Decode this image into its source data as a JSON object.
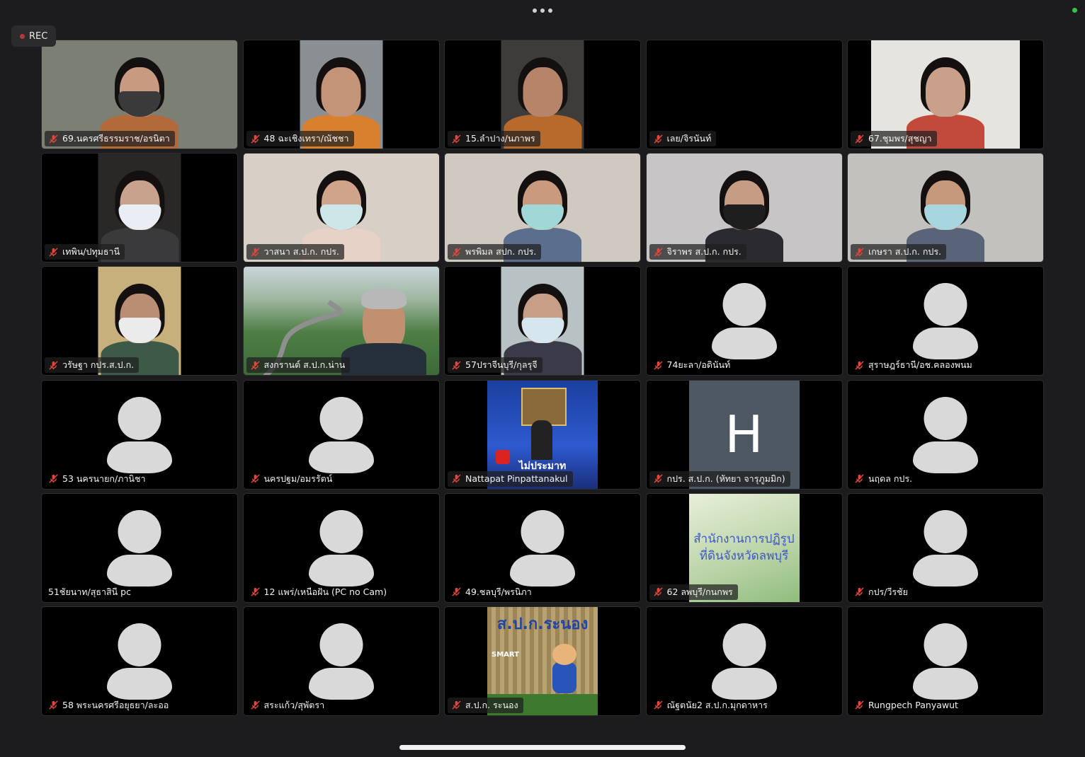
{
  "rec_label": "REC",
  "participants": [
    {
      "name": "69.นครศรีธรรมราช/อรนิตา",
      "muted": true,
      "video": "person",
      "vw": "full",
      "bg": "#7c7f74",
      "skin": "#c89b80",
      "maskc": "#3a3a3a",
      "shirtc": "#b36a3a"
    },
    {
      "name": "48 ฉะเชิงเทรา/ณัชชา",
      "muted": true,
      "video": "person",
      "vw": "v-narrow",
      "bg": "#8a8f94",
      "skin": "#c49479",
      "maskc": "",
      "shirtc": "#d9802e"
    },
    {
      "name": "15.ลำปาง/นภาพร",
      "muted": true,
      "video": "person",
      "vw": "v-narrow",
      "bg": "#3e3c3a",
      "skin": "#b68468",
      "maskc": "",
      "shirtc": "#b86a2c"
    },
    {
      "name": "เลย/จิรนันท์",
      "muted": true,
      "video": "none"
    },
    {
      "name": "67.ชุมพร/สุชญา",
      "muted": true,
      "video": "person",
      "vw": "v-wide",
      "bg": "#e6e4df",
      "skin": "#c9a08a",
      "maskc": "",
      "shirtc": "#c24a3a"
    },
    {
      "name": "เทพิน/ปทุมธานี",
      "muted": true,
      "video": "person",
      "vw": "v-narrow",
      "bg": "#2a2826",
      "skin": "#c8a28c",
      "maskc": "#e8eef4",
      "shirtc": "#3a3a3c"
    },
    {
      "name": "วาสนา ส.ป.ก. กปร.",
      "muted": true,
      "video": "person",
      "vw": "full",
      "bg": "#d8d0c6",
      "skin": "#d0a48a",
      "maskc": "#cde6e8",
      "shirtc": "#e6d2c6"
    },
    {
      "name": "พรพิมล  สปก. กปร.",
      "muted": true,
      "video": "person",
      "vw": "full",
      "bg": "#cfc9c1",
      "skin": "#c99a7e",
      "maskc": "#9fd8d6",
      "shirtc": "#5b6e8e"
    },
    {
      "name": "จิราพร ส.ป.ก. กปร.",
      "muted": true,
      "video": "person",
      "vw": "full",
      "bg": "#c7c5c6",
      "skin": "#c79c84",
      "maskc": "#1e1e1e",
      "shirtc": "#2a2a30"
    },
    {
      "name": "เกษรา ส.ป.ก. กปร.",
      "muted": true,
      "video": "person",
      "vw": "full",
      "bg": "#c2c1bd",
      "skin": "#c6987c",
      "maskc": "#a8d6de",
      "shirtc": "#5a6478"
    },
    {
      "name": "วรัษฐา กปร.ส.ป.ก.",
      "muted": true,
      "video": "person",
      "vw": "v-narrow",
      "bg": "#c8b07c",
      "skin": "#b98e72",
      "maskc": "#ebebeb",
      "shirtc": "#3d5a48"
    },
    {
      "name": "สงกรานต์ ส.ป.ก.น่าน",
      "muted": true,
      "video": "landscape",
      "vw": "full",
      "bg": "#5e8d55",
      "skin": "#c09070",
      "maskc": "",
      "shirtc": "#26303a"
    },
    {
      "name": "57ปราจีนบุรี/กุลรุจี",
      "muted": true,
      "video": "person",
      "vw": "v-narrow",
      "bg": "#b8c2c4",
      "skin": "#c79e86",
      "maskc": "#d6e6ef",
      "shirtc": "#3a3a48"
    },
    {
      "name": "74ยะลา/อดินันท์",
      "muted": true,
      "video": "avatar"
    },
    {
      "name": "สุราษฎร์ธานี/อช.คลองพนม",
      "muted": true,
      "video": "avatar"
    },
    {
      "name": "53 นครนายก/ภานิชา",
      "muted": true,
      "video": "avatar"
    },
    {
      "name": "นครปฐม/อมรรัตน์",
      "muted": true,
      "video": "avatar"
    },
    {
      "name": "Nattapat Pinpattanakul",
      "muted": true,
      "video": "poster",
      "poster_text": "ไม่ประมาท",
      "vw": "v-mid"
    },
    {
      "name": "กปร. ส.ป.ก. (หัทยา จารุภูมมิก)",
      "muted": true,
      "video": "letter",
      "letter": "H",
      "vw": "v-mid"
    },
    {
      "name": "นฤดล กปร.",
      "muted": true,
      "video": "avatar"
    },
    {
      "name": "51ชัยนาท/สุธาสินี pc",
      "muted": false,
      "video": "avatar"
    },
    {
      "name": "12 แพร่/เหนือฝัน (PC no Cam)",
      "muted": true,
      "video": "avatar"
    },
    {
      "name": "49.ชลบุรี/พรนิภา",
      "muted": true,
      "video": "avatar"
    },
    {
      "name": "62 ลพบุรี/กนกพร",
      "muted": true,
      "video": "lopburi",
      "line1": "สำนักงานการปฏิรูป",
      "line2": "ที่ดินจังหวัดลพบุรี",
      "vw": "v-mid"
    },
    {
      "name": "กปร/วีรชัย",
      "muted": true,
      "video": "avatar"
    },
    {
      "name": "58 พระนครศรีอยุธยา/ละออ",
      "muted": true,
      "video": "avatar"
    },
    {
      "name": "สระแก้ว/สุพัตรา",
      "muted": true,
      "video": "avatar"
    },
    {
      "name": "ส.ป.ก. ระนอง",
      "muted": true,
      "video": "ranong",
      "sign": "ส.ป.ก.ระนอง",
      "smart": "SMART",
      "vw": "v-mid"
    },
    {
      "name": "ณัฐตนัย2 ส.ป.ก.มุกดาหาร",
      "muted": true,
      "video": "avatar"
    },
    {
      "name": "Rungpech Panyawut",
      "muted": true,
      "video": "avatar"
    }
  ],
  "colors": {
    "background": "#1c1c1e",
    "tile": "#000000",
    "mute": "#e0463a",
    "avatar": "#d9d9d9"
  }
}
